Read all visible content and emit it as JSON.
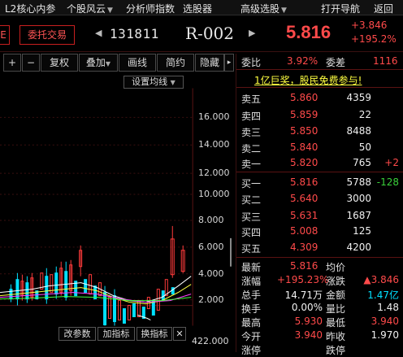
{
  "menu": {
    "items": [
      {
        "label": "L2核心内参",
        "arrow": false
      },
      {
        "label": "个股风云",
        "arrow": true
      },
      {
        "label": "分析师指数",
        "arrow": false
      },
      {
        "label": "选股器",
        "arrow": false
      },
      {
        "label": "高级选股",
        "arrow": true
      },
      {
        "label": "打开导航",
        "arrow": false
      },
      {
        "label": "返回",
        "arrow": false
      }
    ]
  },
  "header": {
    "left_btn": "E",
    "trade_btn": "委托交易",
    "prev_icon": "◀",
    "next_icon": "▶",
    "code": "131811",
    "name": "R-002",
    "price": "5.816",
    "change": "+3.846",
    "change_pct": "+195.2%"
  },
  "toolbar": {
    "plus": "+",
    "minus": "−",
    "fuquan": "复权",
    "diejia": "叠加",
    "huaxian": "画线",
    "jianyue": "简约",
    "yincang": "隐藏",
    "expand": "▸",
    "set_ma": "设置均线"
  },
  "chart": {
    "y_ticks": [
      "16.000",
      "14.000",
      "12.000",
      "10.000",
      "8.000",
      "6.000",
      "4.000",
      "2.000"
    ],
    "vol_label": "422.000"
  },
  "bottombar": {
    "gai_canshu": "改参数",
    "jia_zhibiao": "加指标",
    "huan_zhibiao": "换指标",
    "close": "✕"
  },
  "order": {
    "weibi_label": "委比",
    "weibi_value": "3.92%",
    "weicha_label": "委差",
    "weicha_value": "1116",
    "promo": "1亿巨奖，股民免费参与!",
    "asks": [
      {
        "label": "卖五",
        "price": "5.860",
        "vol": "4359",
        "delta": ""
      },
      {
        "label": "卖四",
        "price": "5.859",
        "vol": "22",
        "delta": ""
      },
      {
        "label": "卖三",
        "price": "5.850",
        "vol": "8488",
        "delta": ""
      },
      {
        "label": "卖二",
        "price": "5.840",
        "vol": "50",
        "delta": ""
      },
      {
        "label": "卖一",
        "price": "5.820",
        "vol": "765",
        "delta": "+2"
      }
    ],
    "bids": [
      {
        "label": "买一",
        "price": "5.816",
        "vol": "5788",
        "delta": "-128"
      },
      {
        "label": "买二",
        "price": "5.640",
        "vol": "3000",
        "delta": ""
      },
      {
        "label": "买三",
        "price": "5.631",
        "vol": "1687",
        "delta": ""
      },
      {
        "label": "买四",
        "price": "5.008",
        "vol": "125",
        "delta": ""
      },
      {
        "label": "买五",
        "price": "4.309",
        "vol": "4200",
        "delta": ""
      }
    ]
  },
  "quote": {
    "rows": [
      {
        "l1": "最新",
        "v1": "5.816",
        "l2": "均价",
        "v2": ""
      },
      {
        "l1": "涨幅",
        "v1": "+195.23%",
        "l2": "涨跌",
        "v2": "▲3.846"
      },
      {
        "l1": "总手",
        "v1": "14.71万",
        "l2": "金额",
        "v2": "1.47亿"
      },
      {
        "l1": "换手",
        "v1": "0.00%",
        "l2": "量比",
        "v2": "1.48"
      },
      {
        "l1": "最高",
        "v1": "5.930",
        "l2": "最低",
        "v2": "3.940"
      },
      {
        "l1": "今开",
        "v1": "3.940",
        "l2": "昨收",
        "v2": "1.970"
      },
      {
        "l1": "涨停",
        "v1": "",
        "l2": "跌停",
        "v2": ""
      }
    ]
  },
  "colors": {
    "up": "#ff4a4a",
    "down": "#00e0ff",
    "accent": "#c81f1f",
    "promo": "#ffff40"
  }
}
